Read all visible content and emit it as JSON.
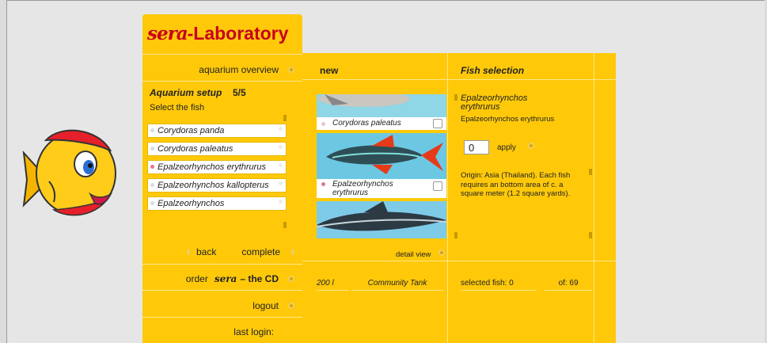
{
  "brand": {
    "logo_mark": "sera",
    "logo_text": "-Laboratory"
  },
  "nav": {
    "aquarium_overview": "aquarium overview",
    "back": "back",
    "complete": "complete",
    "order_prefix": "order",
    "order_brand": "sera",
    "order_suffix": "– the CD",
    "logout": "logout",
    "last_login": "last login:"
  },
  "setup": {
    "title": "Aquarium setup",
    "step": "5/5",
    "instruction": "Select the fish",
    "fish_list": [
      {
        "name": "Corydoras panda",
        "selected": false
      },
      {
        "name": "Corydoras paleatus",
        "selected": false
      },
      {
        "name": "Epalzeorhynchos erythrurus",
        "selected": true
      },
      {
        "name": "Epalzeorhynchos kallopterus",
        "selected": false
      },
      {
        "name": "Epalzeorhynchos",
        "selected": false
      }
    ]
  },
  "main": {
    "col_new": "new",
    "col_selection": "Fish selection",
    "captions": [
      "Corydoras paleatus",
      "Epalzeorhynchos erythrurus"
    ],
    "detail_view": "detail view",
    "info": {
      "latin_name": "Epalzeorhynchos erythrurus",
      "common_name": "Epalzeorhynchos erythrurus",
      "quantity": "0",
      "apply": "apply",
      "origin": "Origin: Asia (Thailand). Each fish requires an bottom area of c. a square meter (1.2 square yards)."
    },
    "footer": {
      "volume": "200 l",
      "tank_type": "Community Tank",
      "selected": "selected fish: 0",
      "of": "of: 69"
    }
  },
  "colors": {
    "panel": "#ffc90a",
    "logo": "#c8001e",
    "background": "#e6e6e6"
  }
}
